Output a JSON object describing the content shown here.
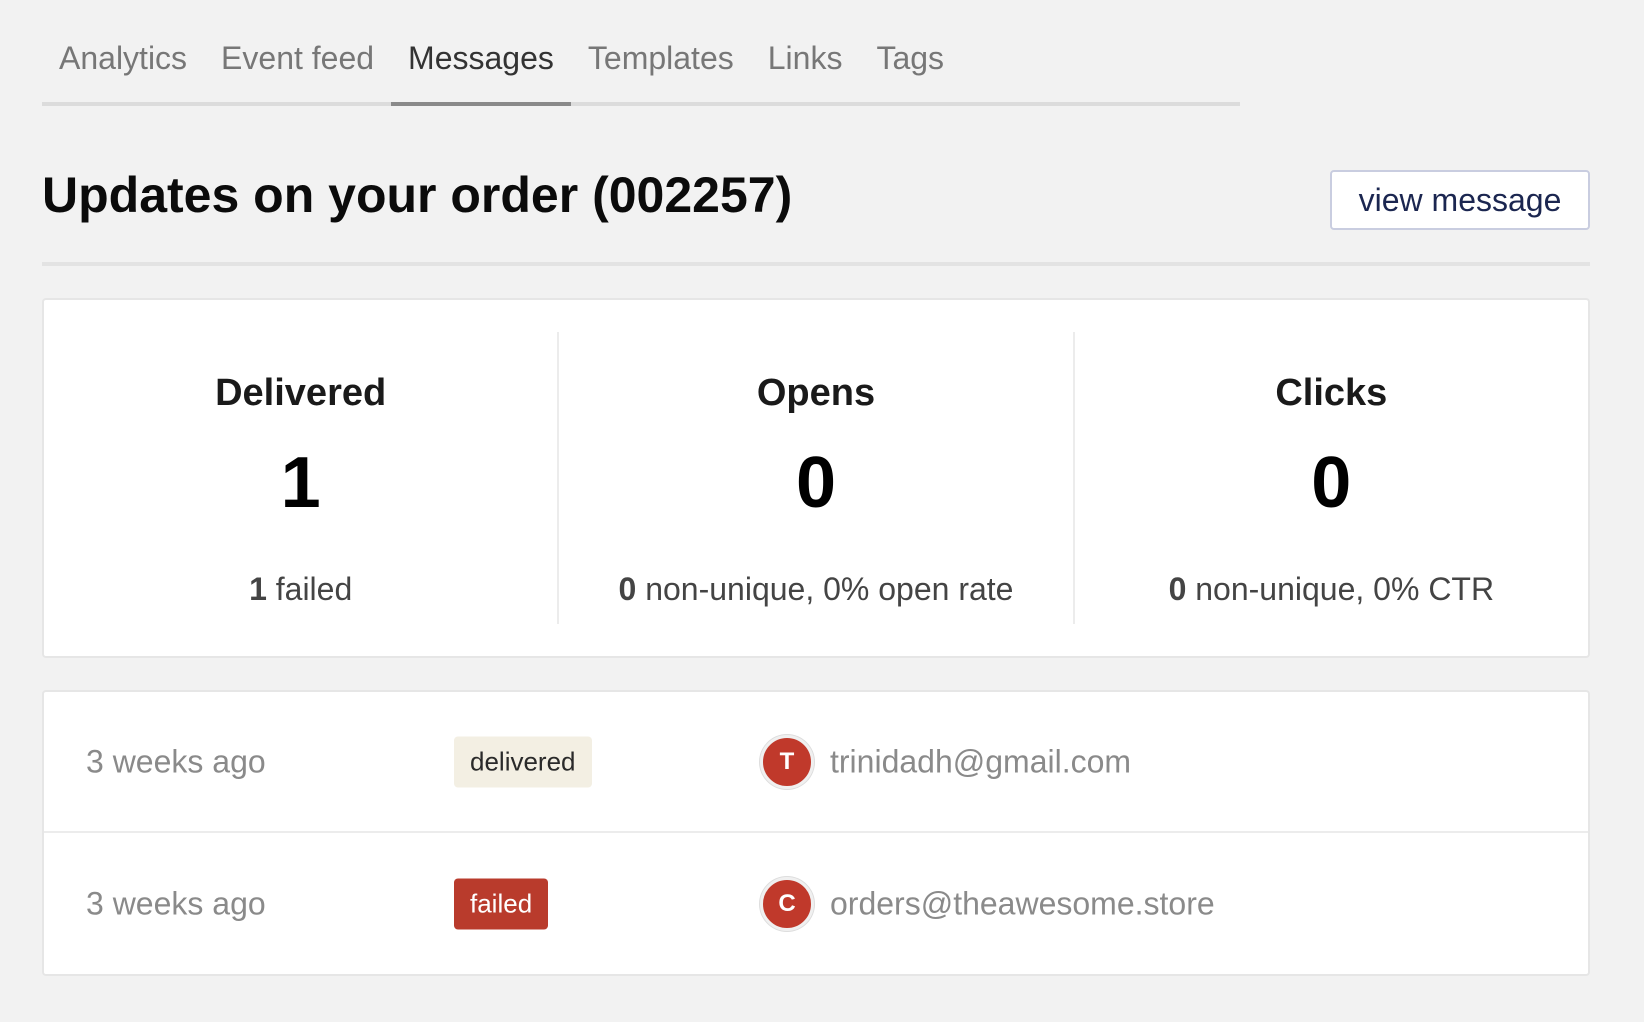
{
  "tabs": [
    {
      "label": "Analytics",
      "active": false
    },
    {
      "label": "Event feed",
      "active": false
    },
    {
      "label": "Messages",
      "active": true
    },
    {
      "label": "Templates",
      "active": false
    },
    {
      "label": "Links",
      "active": false
    },
    {
      "label": "Tags",
      "active": false
    }
  ],
  "header": {
    "title": "Updates on your order (002257)",
    "view_button": "view message"
  },
  "stats": [
    {
      "label": "Delivered",
      "value": "1",
      "sub_strong": "1",
      "sub_text": " failed"
    },
    {
      "label": "Opens",
      "value": "0",
      "sub_strong": "0",
      "sub_text": " non-unique, 0% open rate"
    },
    {
      "label": "Clicks",
      "value": "0",
      "sub_strong": "0",
      "sub_text": " non-unique, 0% CTR"
    }
  ],
  "messages": [
    {
      "time": "3 weeks ago",
      "status": "delivered",
      "avatar_initial": "T",
      "email": "trinidadh@gmail.com"
    },
    {
      "time": "3 weeks ago",
      "status": "failed",
      "avatar_initial": "C",
      "email": "orders@theawesome.store"
    }
  ],
  "colors": {
    "background": "#f2f2f2",
    "avatar": "#c0392b",
    "failed_badge": "#b93b2c",
    "delivered_badge": "#f3efe3",
    "button_text": "#1b2650"
  }
}
